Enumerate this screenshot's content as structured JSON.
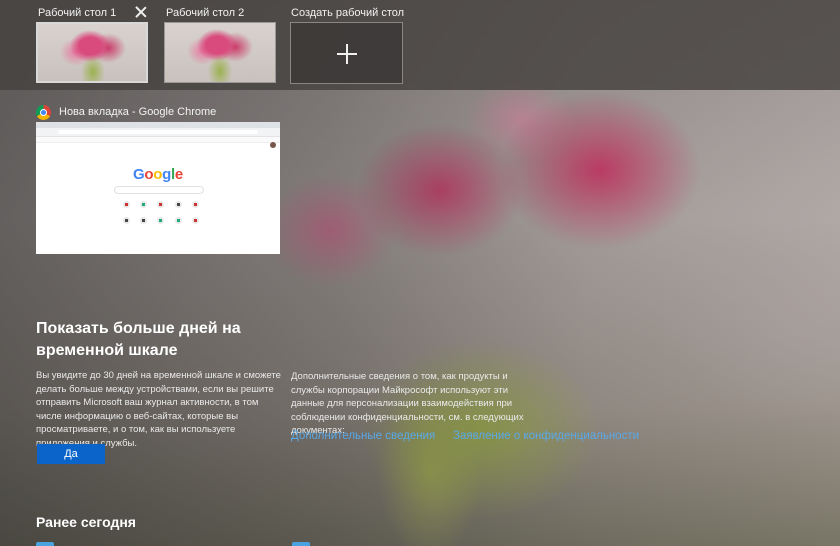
{
  "desktops": [
    {
      "label": "Рабочий стол 1",
      "active": true
    },
    {
      "label": "Рабочий стол 2",
      "active": false
    }
  ],
  "new_desktop_label": "Создать рабочий стол",
  "window_preview": {
    "title": "Нова вкладка - Google Chrome",
    "icon": "chrome-icon",
    "logo_text": "Google"
  },
  "timeline_banner": {
    "title": "Показать больше дней на временной шкале",
    "body": "Вы увидите до 30 дней на временной шкале и сможете делать больше между устройствами, если вы решите отправить Microsoft ваш журнал активности, в том числе информацию о веб-сайтах, которые вы просматриваете, и о том, как вы используете приложения и службы.",
    "yes_label": "Да",
    "privacy_text": "Дополнительные сведения о том, как продукты и службы корпорации Майкрософт используют эти данные для персонализации взаимодействия при соблюдении конфиденциальности, см. в следующих документах:",
    "link_more": "Дополнительные сведения",
    "link_privacy": "Заявление о конфиденциальности"
  },
  "section_heading": "Ранее сегодня",
  "colors": {
    "accent_button": "#0a64c9",
    "link": "#5aa9e8"
  }
}
